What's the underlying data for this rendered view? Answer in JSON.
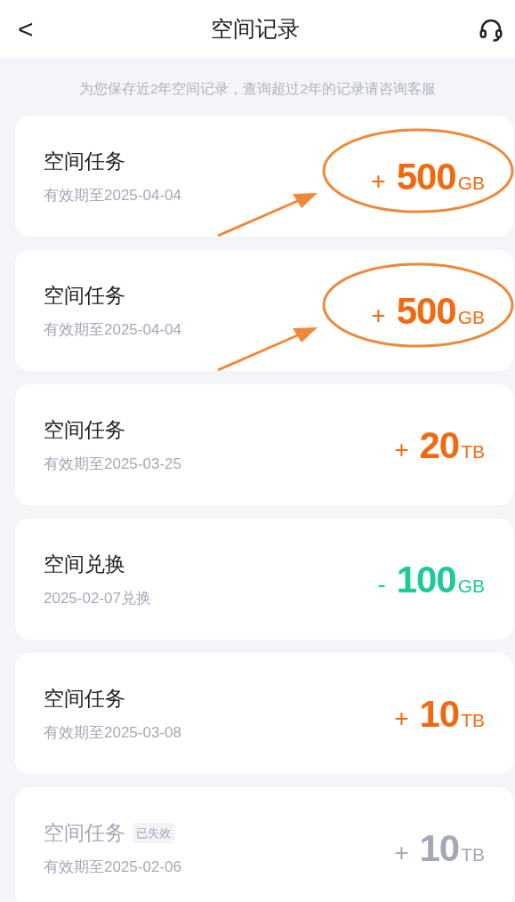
{
  "header": {
    "back": "<",
    "title": "空间记录"
  },
  "notice": "为您保存近2年空间记录，查询超过2年的记录请咨询客服",
  "records": [
    {
      "title": "空间任务",
      "subtitle": "有效期至2025-04-04",
      "sign": "+",
      "amount": "500",
      "unit": "GB",
      "kind": "gain",
      "expired": false,
      "annotated": true
    },
    {
      "title": "空间任务",
      "subtitle": "有效期至2025-04-04",
      "sign": "+",
      "amount": "500",
      "unit": "GB",
      "kind": "gain",
      "expired": false,
      "annotated": true
    },
    {
      "title": "空间任务",
      "subtitle": "有效期至2025-03-25",
      "sign": "+",
      "amount": "20",
      "unit": "TB",
      "kind": "gain",
      "expired": false,
      "annotated": false
    },
    {
      "title": "空间兑换",
      "subtitle": "2025-02-07兑换",
      "sign": "-",
      "amount": "100",
      "unit": "GB",
      "kind": "spend",
      "expired": false,
      "annotated": false
    },
    {
      "title": "空间任务",
      "subtitle": "有效期至2025-03-08",
      "sign": "+",
      "amount": "10",
      "unit": "TB",
      "kind": "gain",
      "expired": false,
      "annotated": false
    },
    {
      "title": "空间任务",
      "badge": "已失效",
      "subtitle": "有效期至2025-02-06",
      "sign": "+",
      "amount": "10",
      "unit": "TB",
      "kind": "gain",
      "expired": true,
      "annotated": false
    }
  ]
}
